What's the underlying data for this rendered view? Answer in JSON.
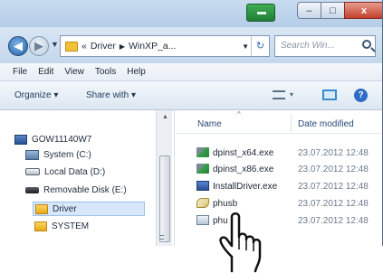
{
  "window": {
    "controls": {
      "minimize": "–",
      "maximize": "□",
      "close": "x"
    }
  },
  "address": {
    "back_glyph": "◀",
    "forward_glyph": "▶",
    "history_glyph": "▼",
    "overflow": "«",
    "segments": [
      "Driver",
      "WinXP_a..."
    ],
    "separator": "▶",
    "dropdown_glyph": "▼",
    "refresh_glyph": "↻",
    "search_placeholder": "Search Win..."
  },
  "menu": [
    "File",
    "Edit",
    "View",
    "Tools",
    "Help"
  ],
  "toolbar": {
    "organize": "Organize ▾",
    "share": "Share with ▾",
    "view_dropdown": "▾",
    "help": "?"
  },
  "nav_pane": {
    "items": [
      {
        "label": "GOW11140W7",
        "icon": "computer-icon"
      },
      {
        "label": "System (C:)",
        "icon": "system-drive-icon"
      },
      {
        "label": "Local Data (D:)",
        "icon": "local-drive-icon"
      },
      {
        "label": "Removable Disk (E:)",
        "icon": "usb-drive-icon"
      },
      {
        "label": "Driver",
        "icon": "folder-icon",
        "selected": true
      },
      {
        "label": "SYSTEM",
        "icon": "folder-icon"
      }
    ],
    "scroll_up": "▲"
  },
  "file_list": {
    "columns": {
      "name": "Name",
      "date": "Date modified",
      "sort_caret": "^"
    },
    "rows": [
      {
        "name": "dpinst_x64.exe",
        "date": "23.07.2012 12:48",
        "icon": "exe-icon"
      },
      {
        "name": "dpinst_x86.exe",
        "date": "23.07.2012 12:48",
        "icon": "exe-icon"
      },
      {
        "name": "InstallDriver.exe",
        "date": "23.07.2012 12:48",
        "icon": "installer-icon"
      },
      {
        "name": "phusb",
        "date": "23.07.2012 12:48",
        "icon": "catalog-icon"
      },
      {
        "name": "phu",
        "date": "23.07.2012 12:48",
        "icon": "generic-file-icon"
      }
    ]
  },
  "colors": {
    "selection": "#d7e7f9",
    "titlebar": "#b4cde8",
    "accent": "#2f6bc6"
  }
}
